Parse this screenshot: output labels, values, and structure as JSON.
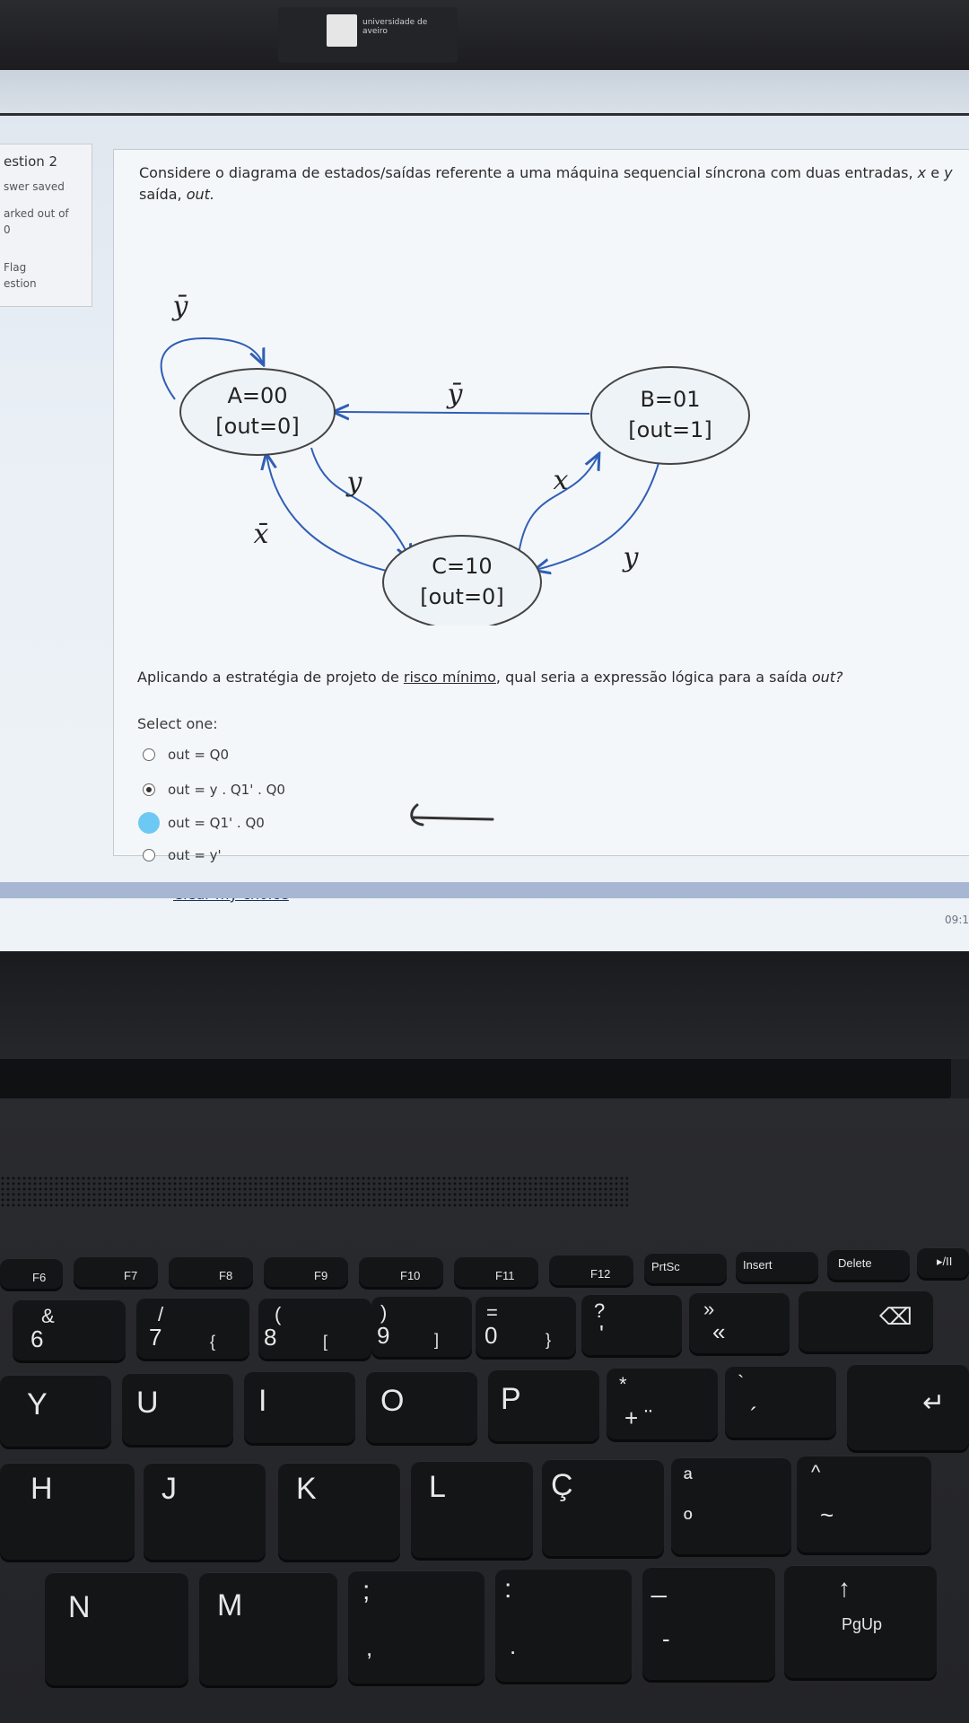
{
  "logo": {
    "text": "universidade de aveiro"
  },
  "question_info": {
    "number": "estion 2",
    "status": "swer saved",
    "marks": "arked out of",
    "marks_value": "0",
    "flag": "Flag",
    "flag2": "estion"
  },
  "question": {
    "text_prefix": "Considere o diagrama de estados/saídas referente a uma máquina sequencial síncrona com duas entradas,",
    "input_x": "x",
    "text_e": "e",
    "input_y": "y",
    "text_line2": "saída,",
    "output_name": "out.",
    "prompt_before": "Aplicando a estratégia de projeto de",
    "prompt_link": "risco mínimo",
    "prompt_after": ", qual seria a expressão lógica para a saída",
    "prompt_out": "out?",
    "select_one": "Select one:",
    "options": [
      {
        "label": "out = Q0",
        "state": "unchecked"
      },
      {
        "label": "out = y . Q1' . Q0",
        "state": "checked"
      },
      {
        "label": "out = Q1' . Q0",
        "state": "hover"
      },
      {
        "label": "out = y'",
        "state": "unchecked"
      }
    ],
    "clear_choice": "Clear my choice"
  },
  "diagram": {
    "states": [
      {
        "name": "A=00",
        "output": "[out=0]"
      },
      {
        "name": "B=01",
        "output": "[out=1]"
      },
      {
        "name": "C=10",
        "output": "[out=0]"
      }
    ],
    "transitions": {
      "A_self": "ȳ",
      "B_to_A": "ȳ",
      "A_to_C": "y",
      "C_to_B": "x",
      "B_to_C": "y",
      "C_to_A": "x̄"
    }
  },
  "clock": "09:1",
  "keyboard": {
    "fn_keys": [
      "F6",
      "F7",
      "F8",
      "F9",
      "F10",
      "F11",
      "F12",
      "PrtSc",
      "Insert",
      "Delete",
      "▸/II"
    ],
    "number_row": [
      {
        "top": "&",
        "bottom": "6"
      },
      {
        "top": "/",
        "bottom": "7",
        "alt": "{"
      },
      {
        "top": "(",
        "bottom": "8",
        "alt": "["
      },
      {
        "top": ")",
        "bottom": "9",
        "alt": "]"
      },
      {
        "top": "=",
        "bottom": "0",
        "alt": "}"
      },
      {
        "top": "?",
        "bottom": "'"
      },
      {
        "top": "»",
        "bottom": "«"
      }
    ],
    "backspace_glyph": "⌫",
    "row_q": [
      "Y",
      "U",
      "I",
      "O",
      "P"
    ],
    "row_q_extra": [
      {
        "top": "*",
        "bottom": "+ ¨"
      },
      {
        "top": "`",
        "bottom": "´"
      }
    ],
    "enter_glyph": "↵",
    "row_a": [
      "H",
      "J",
      "K",
      "L",
      "Ç"
    ],
    "row_a_extra": [
      {
        "top": "ª",
        "bottom": "º"
      },
      {
        "top": "^",
        "bottom": "~"
      }
    ],
    "row_z": [
      "N",
      "M"
    ],
    "row_z_extra": [
      {
        "top": ";",
        "bottom": ","
      },
      {
        "top": ":",
        "bottom": "."
      },
      {
        "top": "_",
        "bottom": "-"
      }
    ],
    "pgup_arrow": "↑",
    "pgup": "PgUp"
  }
}
